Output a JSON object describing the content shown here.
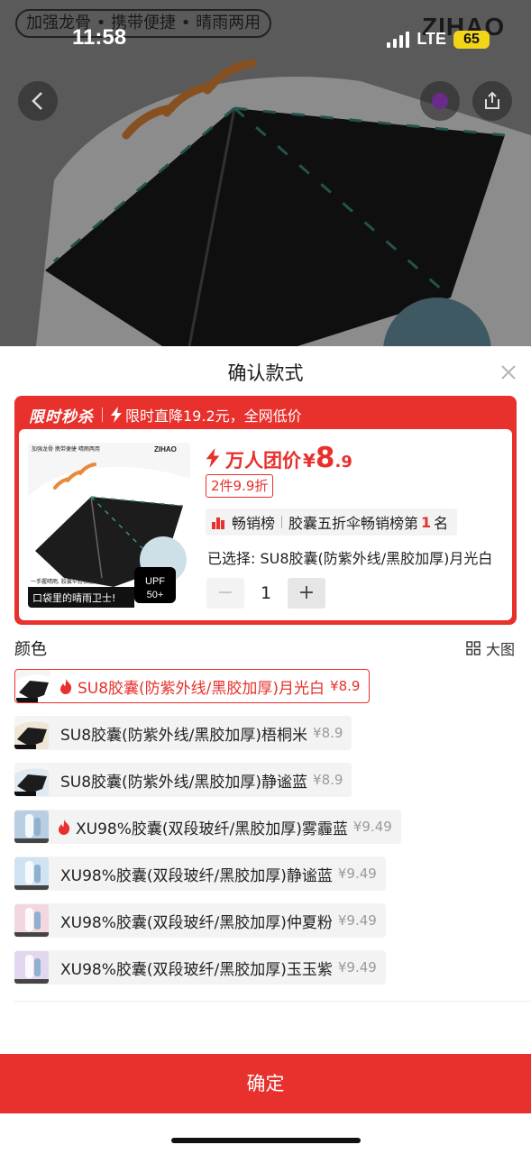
{
  "background": {
    "slogan": "加强龙骨 • 携带便捷 • 晴雨两用",
    "brand": "ZIHAO"
  },
  "status_bar": {
    "time": "11:58",
    "network": "LTE",
    "battery": "65"
  },
  "sheet": {
    "title": "确认款式"
  },
  "promo": {
    "tag": "限时秒杀",
    "text": "限时直降19.2元，全网低价",
    "price_label": "万人团价",
    "currency": "¥",
    "price_int": "8",
    "price_dec": ".9",
    "deal_badge": "2件9.9折",
    "rank_title": "畅销榜",
    "rank_text_before": "胶囊五折伞畅销榜第",
    "rank_number": "1",
    "rank_text_after": "名",
    "selected": "已选择: SU8胶囊(防紫外线/黑胶加厚)月光白",
    "quantity": "1",
    "thumb_slogan": "加强龙骨 携带便捷 晴雨两用",
    "thumb_brand": "ZIHAO",
    "thumb_caption": "一手握晴雨, 胶囊伞轻松进口袋",
    "thumb_tagline": "口袋里的晴雨卫士!",
    "thumb_upf": "UPF",
    "thumb_upf_value": "50+"
  },
  "colors": {
    "section_title": "颜色",
    "big_picture_label": "大图",
    "options": [
      {
        "label": "SU8胶囊(防紫外线/黑胶加厚)月光白",
        "price": "¥8.9",
        "hot": true,
        "selected": true
      },
      {
        "label": "SU8胶囊(防紫外线/黑胶加厚)梧桐米",
        "price": "¥8.9",
        "hot": false,
        "selected": false
      },
      {
        "label": "SU8胶囊(防紫外线/黑胶加厚)静谧蓝",
        "price": "¥8.9",
        "hot": false,
        "selected": false
      },
      {
        "label": "XU98%胶囊(双段玻纤/黑胶加厚)雾霾蓝",
        "price": "¥9.49",
        "hot": true,
        "selected": false
      },
      {
        "label": "XU98%胶囊(双段玻纤/黑胶加厚)静谧蓝",
        "price": "¥9.49",
        "hot": false,
        "selected": false
      },
      {
        "label": "XU98%胶囊(双段玻纤/黑胶加厚)仲夏粉",
        "price": "¥9.49",
        "hot": false,
        "selected": false
      },
      {
        "label": "XU98%胶囊(双段玻纤/黑胶加厚)玉玉紫",
        "price": "¥9.49",
        "hot": false,
        "selected": false
      }
    ]
  },
  "confirm_label": "确定",
  "theme": {
    "accent": "#e8302c"
  }
}
